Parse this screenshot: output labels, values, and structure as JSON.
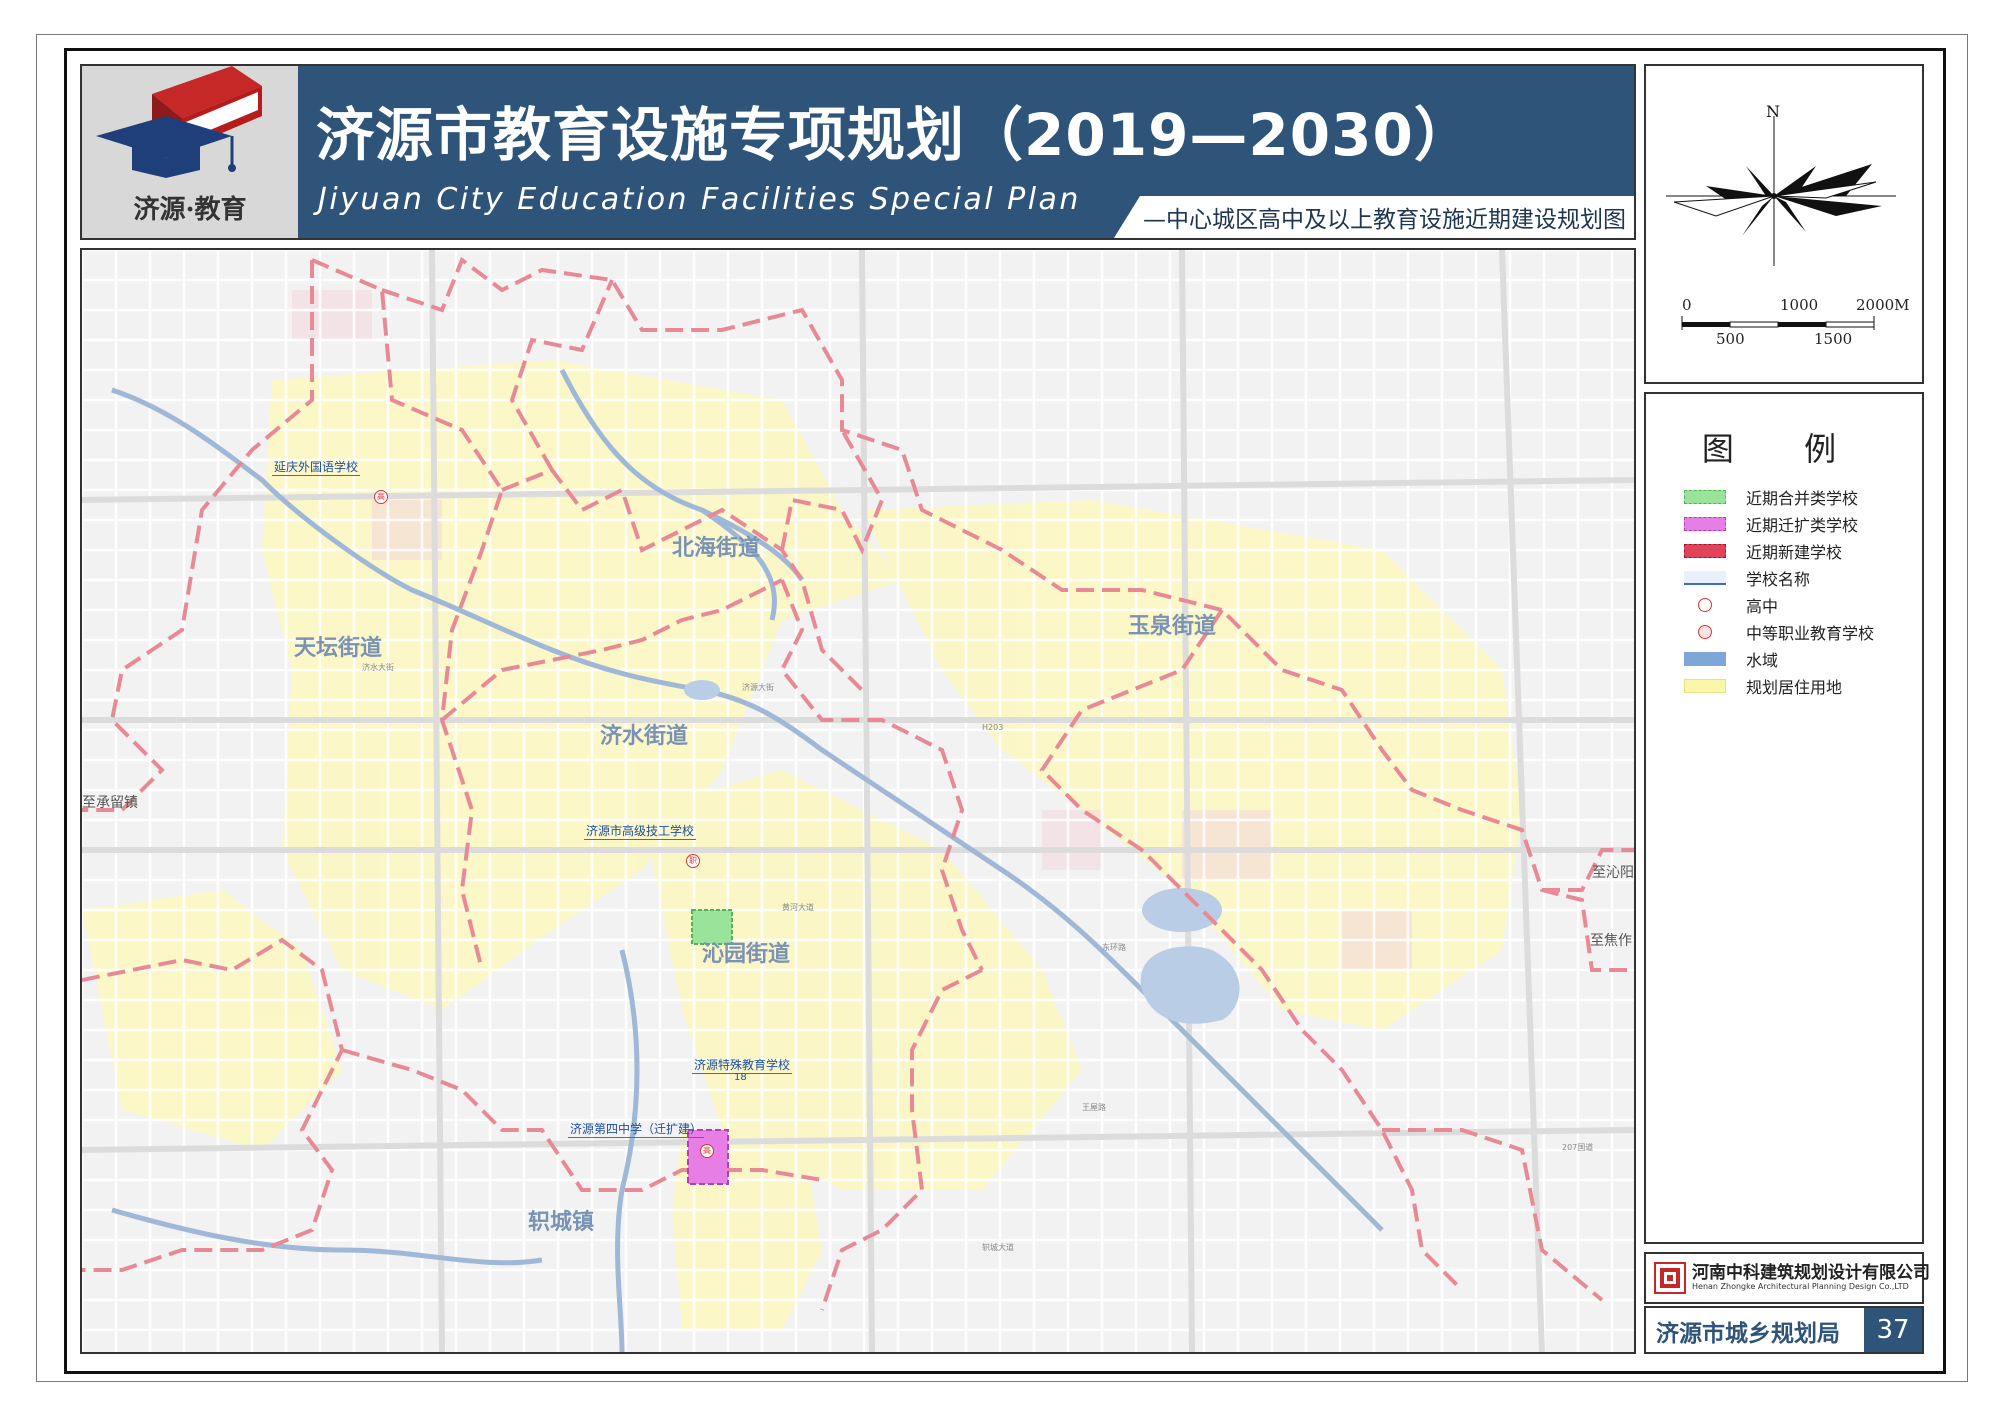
{
  "header": {
    "logo_caption": "济源·教育",
    "title_cn": "济源市教育设施专项规划（2019—2030）",
    "title_en": "Jiyuan City Education Facilities Special Plan",
    "subtitle": "—中心城区高中及以上教育设施近期建设规划图"
  },
  "compass": {
    "north_label": "N",
    "scale_labels_top": [
      "0",
      "1000",
      "2000M"
    ],
    "scale_labels_bottom": [
      "500",
      "1500"
    ]
  },
  "legend": {
    "title": "图 例",
    "items": [
      {
        "label": "近期合并类学校",
        "color": "#8ee08e"
      },
      {
        "label": "近期迁扩类学校",
        "color": "#e67ee6"
      },
      {
        "label": "近期新建学校",
        "color": "#e0445a"
      },
      {
        "label": "学校名称",
        "color": "#3b6fc7"
      },
      {
        "label": "高中",
        "color": "#d33333"
      },
      {
        "label": "中等职业教育学校",
        "color": "#d33333"
      },
      {
        "label": "水域",
        "color": "#7ea6d8"
      },
      {
        "label": "规划居住用地",
        "color": "#fbf7a8"
      }
    ]
  },
  "map": {
    "districts": [
      "北海街道",
      "天坛街道",
      "济水街道",
      "玉泉街道",
      "沁园街道",
      "轵城镇"
    ],
    "place_labels": [
      "至承留镇",
      "至沁阳",
      "至焦作"
    ],
    "schools": [
      {
        "name": "延庆外国语学校",
        "marker": "高"
      },
      {
        "name": "济源市高级技工学校",
        "marker": "职"
      },
      {
        "name": "济源特殊教育学校",
        "number": "18"
      },
      {
        "name": "济源第四中学（迁扩建）",
        "marker": "高"
      }
    ]
  },
  "footer": {
    "company_cn": "河南中科建筑规划设计有限公司",
    "company_en": "Henan Zhongke Architectural Planning Design Co.,LTD",
    "agency": "济源市城乡规划局",
    "page_number": "37"
  },
  "colors": {
    "header_bg": "#2f5479",
    "boundary": "#e88a95",
    "residential": "#fbf7a8",
    "water": "#7ea6d8"
  }
}
